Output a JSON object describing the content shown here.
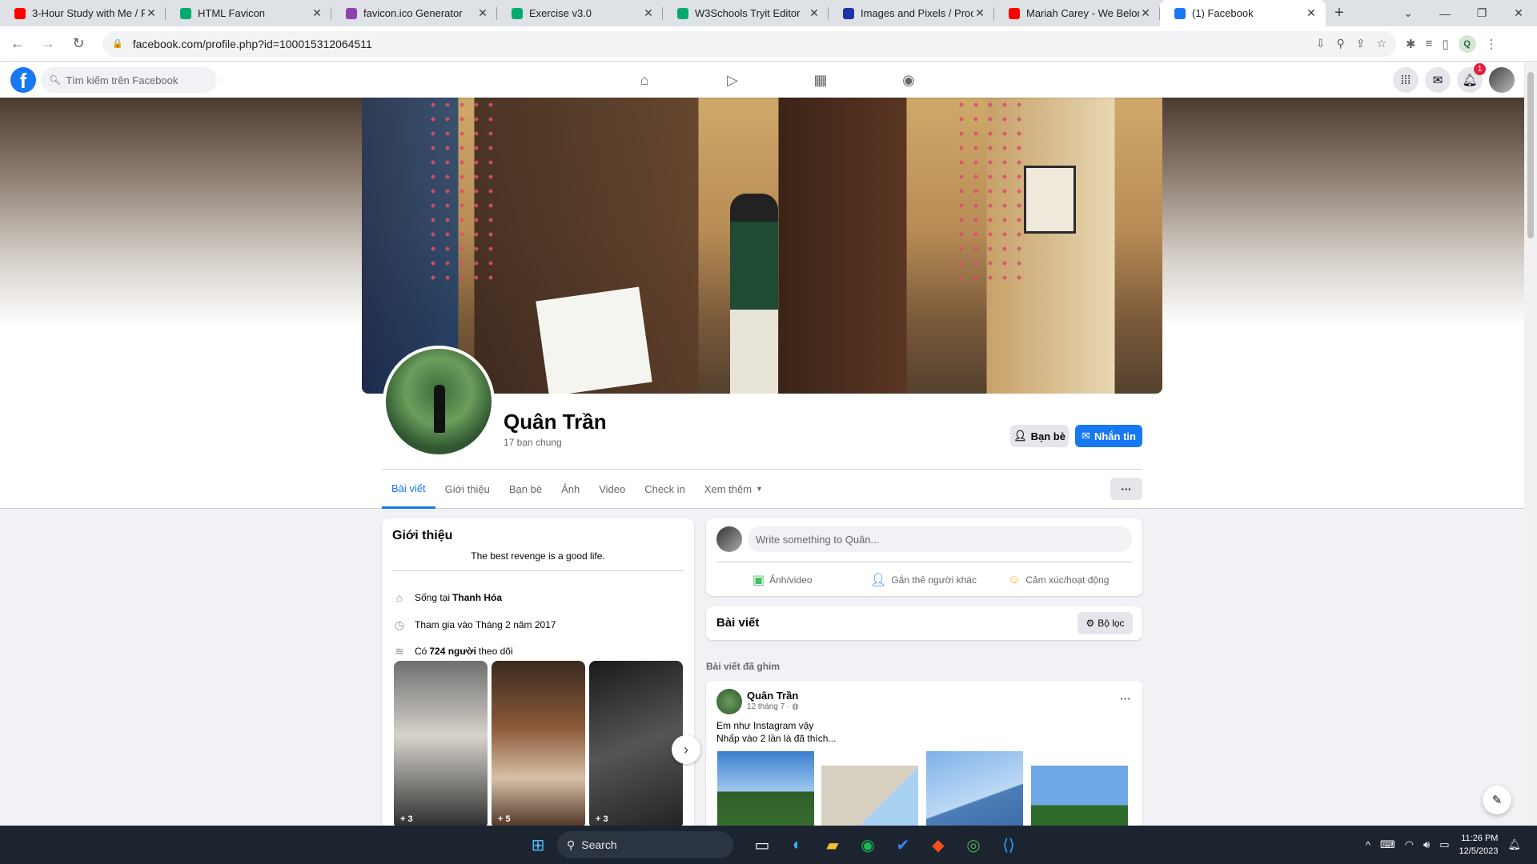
{
  "browser": {
    "tabs": [
      {
        "title": "3-Hour Study with Me / P...",
        "icon": "youtube-icon",
        "color": "#ff0000",
        "active": false
      },
      {
        "title": "HTML Favicon",
        "icon": "w3schools-icon",
        "color": "#04aa6d",
        "active": false
      },
      {
        "title": "favicon.ico Generator",
        "icon": "favicon-generator-icon",
        "color": "#8e44ad",
        "active": false
      },
      {
        "title": "Exercise v3.0",
        "icon": "w3schools-icon",
        "color": "#04aa6d",
        "active": false
      },
      {
        "title": "W3Schools Tryit Editor",
        "icon": "w3schools-icon",
        "color": "#04aa6d",
        "active": false
      },
      {
        "title": "Images and Pixels / Proce...",
        "icon": "processing-icon",
        "color": "#1e32aa",
        "active": false
      },
      {
        "title": "Mariah Carey - We Belong...",
        "icon": "youtube-icon",
        "color": "#ff0000",
        "active": false
      },
      {
        "title": "(1) Facebook",
        "icon": "facebook-icon",
        "color": "#1877f2",
        "active": true
      }
    ],
    "url": "facebook.com/profile.php?id=100015312064511",
    "profile_initial": "Q"
  },
  "fb": {
    "search_placeholder": "Tìm kiếm trên Facebook",
    "notification_count": "1",
    "profile": {
      "name": "Quân Trần",
      "mutual": "17 bạn chung",
      "friends_button": "Bạn bè",
      "message_button": "Nhắn tin"
    },
    "tabs": [
      "Bài viết",
      "Giới thiệu",
      "Bạn bè",
      "Ảnh",
      "Video",
      "Check in",
      "Xem thêm"
    ],
    "intro": {
      "title": "Giới thiệu",
      "bio": "The best revenge is a good life.",
      "lives_prefix": "Sống tại",
      "lives_city": "Thanh Hóa",
      "joined": "Tham gia vào Tháng 2 năm 2017",
      "followers_prefix": "Có",
      "followers_count": "724 người",
      "followers_suffix": "theo dõi",
      "featured_counts": [
        "+ 3",
        "+ 5",
        "+ 3"
      ]
    },
    "composer": {
      "placeholder": "Write something to Quân...",
      "actions": [
        "Ảnh/video",
        "Gắn thẻ người khác",
        "Cảm xúc/hoạt động"
      ]
    },
    "posts": {
      "title": "Bài viết",
      "filter": "Bộ lọc",
      "pinned_label": "Bài viết đã ghim",
      "pinned_post": {
        "author": "Quân Trần",
        "time": "12 tháng 7 · ",
        "line1": "Em như Instagram vậy",
        "line2": "Nhấp vào 2 lần là đã thích..."
      }
    }
  },
  "taskbar": {
    "search": "Search",
    "time": "11:26 PM",
    "date": "12/5/2023"
  },
  "colors": {
    "facebook_blue": "#1877f2",
    "badge_red": "#e41e3f"
  }
}
